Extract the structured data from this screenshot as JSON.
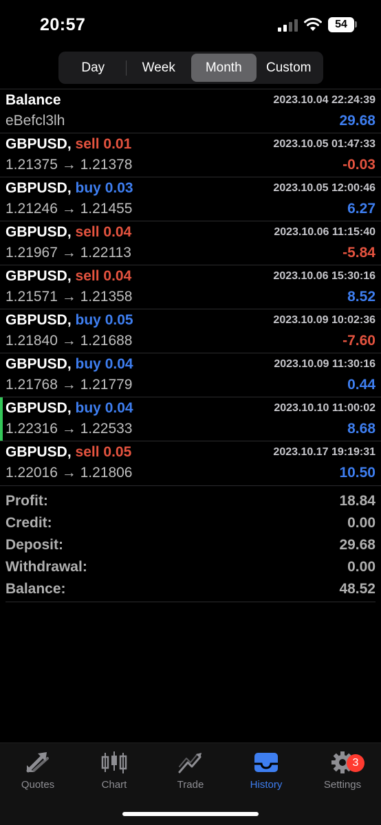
{
  "status": {
    "time": "20:57",
    "battery": "54"
  },
  "segments": [
    {
      "label": "Day",
      "active": false
    },
    {
      "label": "Week",
      "active": false
    },
    {
      "label": "Month",
      "active": true
    },
    {
      "label": "Custom",
      "active": false
    }
  ],
  "balance_entry": {
    "title": "Balance",
    "comment": "eBefcl3lh",
    "time": "2023.10.04 22:24:39",
    "amount": "29.68"
  },
  "trades": [
    {
      "symbol": "GBPUSD,",
      "side": "sell 0.01",
      "type": "sell",
      "prices": "1.21375 → 1.21378",
      "time": "2023.10.05 01:47:33",
      "profit": "-0.03"
    },
    {
      "symbol": "GBPUSD,",
      "side": "buy 0.03",
      "type": "buy",
      "prices": "1.21246 → 1.21455",
      "time": "2023.10.05 12:00:46",
      "profit": "6.27"
    },
    {
      "symbol": "GBPUSD,",
      "side": "sell 0.04",
      "type": "sell",
      "prices": "1.21967 → 1.22113",
      "time": "2023.10.06 11:15:40",
      "profit": "-5.84"
    },
    {
      "symbol": "GBPUSD,",
      "side": "sell 0.04",
      "type": "sell",
      "prices": "1.21571 → 1.21358",
      "time": "2023.10.06 15:30:16",
      "profit": "8.52"
    },
    {
      "symbol": "GBPUSD,",
      "side": "buy 0.05",
      "type": "buy",
      "prices": "1.21840 → 1.21688",
      "time": "2023.10.09 10:02:36",
      "profit": "-7.60"
    },
    {
      "symbol": "GBPUSD,",
      "side": "buy 0.04",
      "type": "buy",
      "prices": "1.21768 → 1.21779",
      "time": "2023.10.09 11:30:16",
      "profit": "0.44"
    },
    {
      "symbol": "GBPUSD,",
      "side": "buy 0.04",
      "type": "buy",
      "prices": "1.22316 → 1.22533",
      "time": "2023.10.10 11:00:02",
      "profit": "8.68"
    },
    {
      "symbol": "GBPUSD,",
      "side": "sell 0.05",
      "type": "sell",
      "prices": "1.22016 → 1.21806",
      "time": "2023.10.17 19:19:31",
      "profit": "10.50"
    }
  ],
  "summary": [
    {
      "label": "Profit:",
      "value": "18.84"
    },
    {
      "label": "Credit:",
      "value": "0.00"
    },
    {
      "label": "Deposit:",
      "value": "29.68"
    },
    {
      "label": "Withdrawal:",
      "value": "0.00"
    },
    {
      "label": "Balance:",
      "value": "48.52"
    }
  ],
  "tabs": [
    {
      "label": "Quotes",
      "icon": "quotes-arrows-icon"
    },
    {
      "label": "Chart",
      "icon": "candlestick-icon"
    },
    {
      "label": "Trade",
      "icon": "trend-icon"
    },
    {
      "label": "History",
      "icon": "inbox-icon",
      "active": true
    },
    {
      "label": "Settings",
      "icon": "gear-icon",
      "badge": "3"
    }
  ],
  "colors": {
    "sell": "#e5533f",
    "buy": "#3e7ef0",
    "active_tab": "#3e7ef0",
    "highlight_bar": "#34c759"
  }
}
